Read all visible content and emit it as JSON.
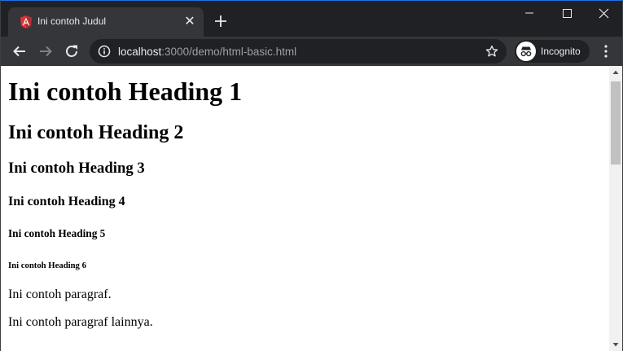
{
  "tab": {
    "title": "Ini contoh Judul",
    "close": "✕"
  },
  "omnibox": {
    "host": "localhost",
    "path": ":3000/demo/html-basic.html"
  },
  "incognito": {
    "label": "Incognito"
  },
  "page": {
    "h1": "Ini contoh Heading 1",
    "h2": "Ini contoh Heading 2",
    "h3": "Ini contoh Heading 3",
    "h4": "Ini contoh Heading 4",
    "h5": "Ini contoh Heading 5",
    "h6": "Ini contoh Heading 6",
    "paragraphs": [
      "Ini contoh paragraf.",
      "Ini contoh paragraf lainnya."
    ]
  },
  "icons": {
    "favicon": "angularjs-icon",
    "new_tab": "plus-icon",
    "minimize": "minimize-icon",
    "maximize": "maximize-icon",
    "close": "close-icon",
    "back": "back-arrow-icon",
    "forward": "forward-arrow-icon",
    "reload": "reload-icon",
    "info": "info-icon",
    "bookmark": "star-icon",
    "incognito": "incognito-icon",
    "menu": "kebab-menu-icon"
  },
  "colors": {
    "frame": "#202124",
    "toolbar": "#35363a",
    "accent": "#1a73e8"
  }
}
